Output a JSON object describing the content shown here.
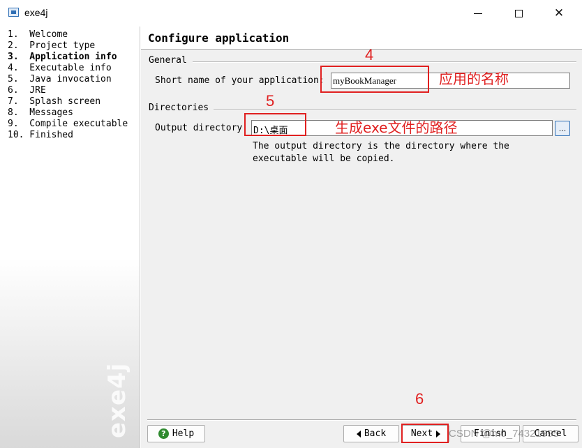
{
  "window": {
    "title": "exe4j",
    "controls": {
      "minimize_icon": "minimize-icon",
      "maximize_icon": "maximize-icon",
      "close_icon": "close-icon"
    }
  },
  "steps": {
    "items": [
      {
        "label": "1.  Welcome"
      },
      {
        "label": "2.  Project type"
      },
      {
        "label": "3.  Application info",
        "current": true
      },
      {
        "label": "4.  Executable info"
      },
      {
        "label": "5.  Java invocation"
      },
      {
        "label": "6.  JRE"
      },
      {
        "label": "7.  Splash screen"
      },
      {
        "label": "8.  Messages"
      },
      {
        "label": "9.  Compile executable"
      },
      {
        "label": "10. Finished"
      }
    ],
    "watermark": "exe4j"
  },
  "main": {
    "title": "Configure application",
    "general": {
      "section_label": "General",
      "short_name_label": "Short name of your application:",
      "short_name_value": "myBookManager"
    },
    "directories": {
      "section_label": "Directories",
      "output_dir_label": "Output directory:",
      "output_dir_value": "D:\\桌面",
      "browse_label": "...",
      "help_text": "The output directory is the directory where the\nexecutable will be copied."
    }
  },
  "buttons": {
    "help": "Help",
    "back": "Back",
    "next": "Next",
    "finish": "Finish",
    "cancel": "Cancel"
  },
  "annotations": {
    "color": "#e02020",
    "step4": {
      "number": "4",
      "note": "应用的名称"
    },
    "step5": {
      "number": "5",
      "note": "生成exe文件的路径"
    },
    "step6": {
      "number": "6"
    }
  },
  "watermark_text": "CSDN @m0_74321995"
}
